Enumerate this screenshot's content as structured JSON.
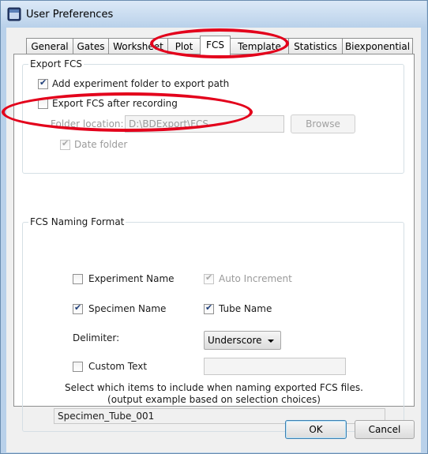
{
  "window": {
    "title": "User Preferences"
  },
  "tabs": [
    {
      "label": "General"
    },
    {
      "label": "Gates"
    },
    {
      "label": "Worksheet"
    },
    {
      "label": "Plot"
    },
    {
      "label": "FCS"
    },
    {
      "label": "Template"
    },
    {
      "label": "Statistics"
    },
    {
      "label": "Biexponential"
    }
  ],
  "active_tab": "FCS",
  "export_fcs": {
    "group_label": "Export FCS",
    "add_folder": {
      "label": "Add experiment folder to export path",
      "checked": true
    },
    "export_after_recording": {
      "label": "Export FCS after recording",
      "checked": false
    },
    "folder_location": {
      "label": "Folder location:",
      "value": "D:\\BDExport\\FCS"
    },
    "browse_label": "Browse",
    "date_folder": {
      "label": "Date folder",
      "checked": true,
      "enabled": false
    }
  },
  "naming": {
    "group_label": "FCS Naming Format",
    "experiment_name": {
      "label": "Experiment Name",
      "checked": false
    },
    "auto_increment": {
      "label": "Auto Increment",
      "checked": true,
      "enabled": false
    },
    "specimen_name": {
      "label": "Specimen Name",
      "checked": true
    },
    "tube_name": {
      "label": "Tube Name",
      "checked": true
    },
    "delimiter_label": "Delimiter:",
    "delimiter_value": "Underscore",
    "custom_text": {
      "label": "Custom Text",
      "checked": false,
      "value": ""
    },
    "help_line1": "Select which items to include when naming exported FCS files.",
    "help_line2": "(output example based on selection choices)",
    "example_output": "Specimen_Tube_001"
  },
  "footer": {
    "ok_label": "OK",
    "cancel_label": "Cancel"
  },
  "annotations": {
    "highlight_color": "#e3001b"
  }
}
